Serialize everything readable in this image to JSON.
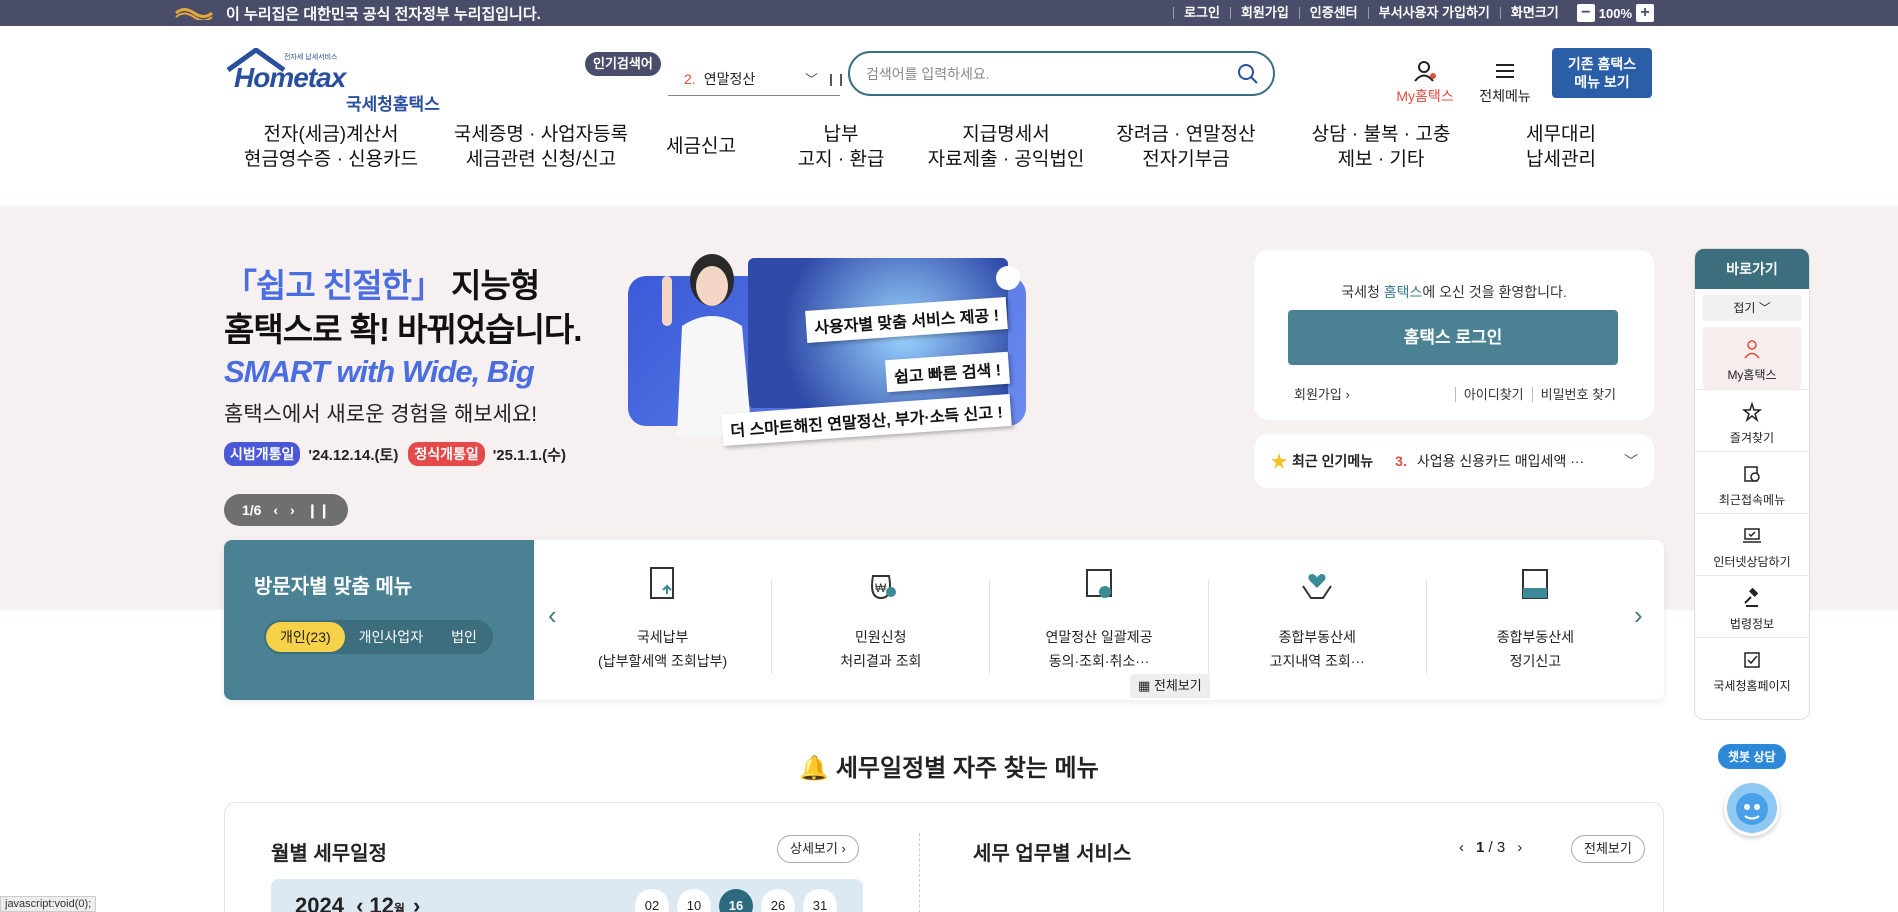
{
  "topbar": {
    "notice": "이 누리집은 대한민국 공식 전자정부 누리집입니다.",
    "links": [
      "로그인",
      "회원가입",
      "인증센터",
      "부서사용자 가입하기",
      "화면크기"
    ],
    "zoom": "100%"
  },
  "logo": {
    "main": "Hometax",
    "sub": "국세청홈택스",
    "tiny": "전자세 납세서비스"
  },
  "popular": {
    "label": "인기검색어",
    "num": "2.",
    "term": "연말정산"
  },
  "search": {
    "placeholder": "검색어를 입력하세요."
  },
  "header_icons": {
    "my": "My홈택스",
    "all": "전체메뉴",
    "old": "기존 홈택스\n메뉴 보기"
  },
  "gnb": [
    "전자(세금)계산서\n현금영수증 · 신용카드",
    "국세증명 · 사업자등록\n세금관련 신청/신고",
    "세금신고",
    "납부\n고지 · 환급",
    "지급명세서\n자료제출 · 공익법인",
    "장려금 · 연말정산\n전자기부금",
    "상담 · 불복 · 고충\n제보 · 기타",
    "세무대리\n납세관리"
  ],
  "hero": {
    "line1_hl": "「쉽고 친절한」",
    "line1": " 지능형",
    "line2": "홈택스로 확! 바뀌었습니다.",
    "smart": "SMART with Wide, Big",
    "sub": "홈택스에서 새로운 경험을 해보세요!",
    "badge1": "시범개통일",
    "date1": "'24.12.14.(토)",
    "badge2": "정식개통일",
    "date2": "'25.1.1.(수)",
    "pager": "1/6",
    "tag1": "사용자별 맞춤 서비스 제공 !",
    "tag2": "쉽고 빠른 검색 !",
    "tag3": "더 스마트해진 연말정산, 부가·소득 신고 !"
  },
  "login": {
    "welcome_pre": "국세청 ",
    "welcome_brand": "홈택스",
    "welcome_post": "에 오신 것을 환영합니다.",
    "button": "홈택스 로그인",
    "join": "회원가입",
    "find_id": "아이디찾기",
    "find_pw": "비밀번호 찾기"
  },
  "recent": {
    "title": "최근 인기메뉴",
    "num": "3.",
    "item": "사업용 신용카드 매입세액 ···"
  },
  "visitor": {
    "title": "방문자별 맞춤 메뉴",
    "tabs": [
      "개인(23)",
      "개인사업자",
      "법인"
    ],
    "items": [
      {
        "l1": "국세납부",
        "l2": "(납부할세액 조회납부)"
      },
      {
        "l1": "민원신청",
        "l2": "처리결과 조회"
      },
      {
        "l1": "연말정산 일괄제공",
        "l2": "동의·조회·취소···"
      },
      {
        "l1": "종합부동산세",
        "l2": "고지내역 조회···"
      },
      {
        "l1": "종합부동산세",
        "l2": "정기신고"
      }
    ],
    "viewall": "전체보기"
  },
  "section": {
    "title": "세무일정별 자주 찾는 메뉴"
  },
  "schedule": {
    "title": "월별 세무일정",
    "detail": "상세보기",
    "year": "2024",
    "month": "12",
    "month_unit": "월",
    "days": [
      "02",
      "10",
      "16",
      "26",
      "31"
    ]
  },
  "services": {
    "title": "세무 업무별 서비스",
    "page": "1",
    "total": "3",
    "all": "전체보기"
  },
  "quick": {
    "head": "바로가기",
    "fold": "접기",
    "items": [
      "My홈택스",
      "즐겨찾기",
      "최근접속메뉴",
      "인터넷상담하기",
      "법령정보",
      "국세청홈페이지"
    ]
  },
  "chatbot": {
    "label": "챗봇 상담"
  },
  "statusbar": "javascript:void(0);"
}
